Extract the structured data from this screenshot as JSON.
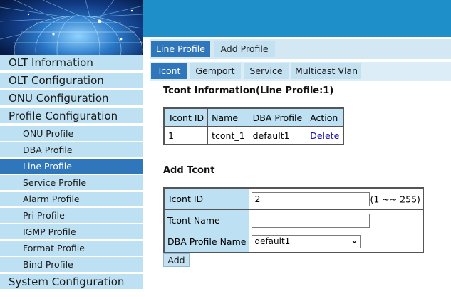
{
  "colors": {
    "topbar": "#1f8fca",
    "nav_bg": "#bde0f2",
    "active": "#2f76bb",
    "link": "#1a0dab"
  },
  "sidebar": {
    "main_items": [
      "OLT Information",
      "OLT Configuration",
      "ONU Configuration",
      "Profile Configuration"
    ],
    "sub_items": [
      "ONU Profile",
      "DBA Profile",
      "Line Profile",
      "Service Profile",
      "Alarm Profile",
      "Pri Profile",
      "IGMP Profile",
      "Format Profile",
      "Bind Profile"
    ],
    "active_sub": "Line Profile",
    "last_item": "System Configuration"
  },
  "top_tabs": [
    "Line Profile",
    "Add Profile"
  ],
  "sub_tabs": [
    "Tcont",
    "Gemport",
    "Service",
    "Multicast Vlan"
  ],
  "tcont_info": {
    "title": "Tcont Information(Line Profile:1)",
    "columns": [
      "Tcont ID",
      "Name",
      "DBA Profile",
      "Action"
    ],
    "rows": [
      {
        "id": "1",
        "name": "tcont_1",
        "dba": "default1",
        "action": "Delete"
      }
    ]
  },
  "add_tcont": {
    "title": "Add Tcont",
    "id_label": "Tcont ID",
    "id_value": "2",
    "id_hint": "(1 ~~ 255)",
    "name_label": "Tcont Name",
    "name_value": "",
    "dba_label": "DBA Profile Name",
    "dba_selected": "default1",
    "add_button": "Add"
  }
}
